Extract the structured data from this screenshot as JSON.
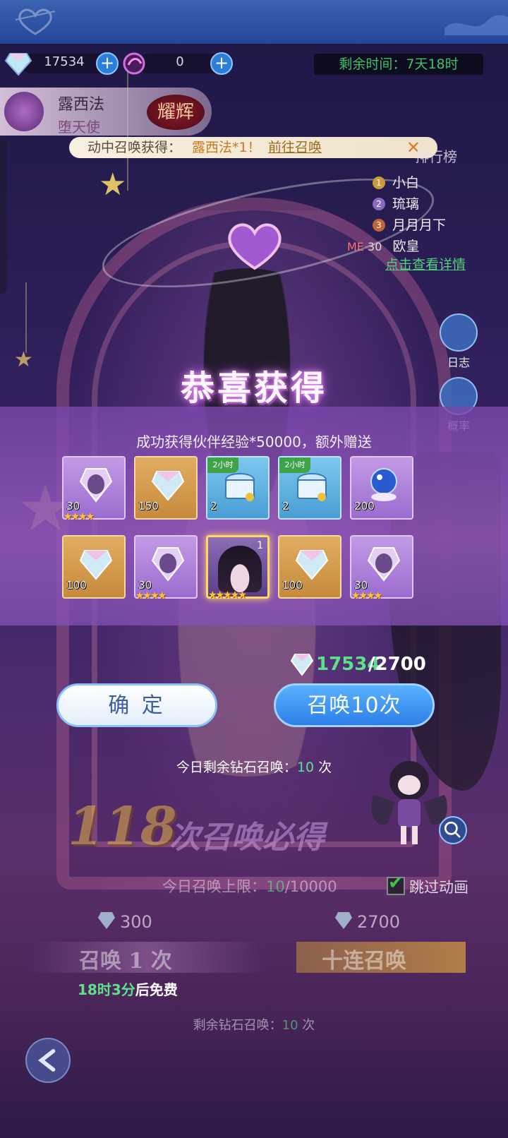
{
  "resources": {
    "diamonds": "17534",
    "soul_gems": "0"
  },
  "event": {
    "timer_label": "剩余时间：7天18时"
  },
  "character": {
    "name": "露西法",
    "title": "堕天使",
    "grade": "耀辉"
  },
  "notice": {
    "prefix": "动中召唤获得：",
    "highlight": "露西法*1！",
    "link": "前往召唤"
  },
  "ranking": {
    "title": "排行榜",
    "entries": [
      {
        "rank": "1",
        "name": "小白"
      },
      {
        "rank": "2",
        "name": "琉璃"
      },
      {
        "rank": "3",
        "name": "月月月下"
      }
    ],
    "me_label": "ME",
    "me_rank": "30",
    "me_name": "欧皇",
    "detail_link": "点击查看详情"
  },
  "side_buttons": {
    "log": "日志",
    "rate": "概率"
  },
  "reward_modal": {
    "title": "恭喜获得",
    "subtitle": "成功获得伙伴经验*50000，额外赠送",
    "items": [
      {
        "type": "purple-crystal",
        "qty": "30",
        "stars": "★★★★"
      },
      {
        "type": "rainbow-diamond",
        "qty": "150",
        "stars": ""
      },
      {
        "type": "treasure-chest",
        "qty": "2",
        "tag": "2小时",
        "stars": ""
      },
      {
        "type": "treasure-chest",
        "qty": "2",
        "tag": "2小时",
        "stars": ""
      },
      {
        "type": "crystal-orb",
        "qty": "200",
        "stars": ""
      },
      {
        "type": "rainbow-diamond",
        "qty": "100",
        "stars": ""
      },
      {
        "type": "purple-crystal",
        "qty": "30",
        "stars": "★★★★"
      },
      {
        "type": "character-card",
        "qty": "1",
        "stars": "★★★★★"
      },
      {
        "type": "rainbow-diamond",
        "qty": "100",
        "stars": ""
      },
      {
        "type": "purple-crystal",
        "qty": "30",
        "stars": "★★★★"
      }
    ],
    "cost_have": "17534",
    "cost_need": "/2700",
    "confirm_label": "确 定",
    "summon10_label": "召唤10次",
    "remaining_prefix": "今日剩余钻石召唤：",
    "remaining_count": "10",
    "remaining_suffix": " 次"
  },
  "background_panel": {
    "guarantee_number": "118",
    "guarantee_text": "次召唤必得",
    "daily_limit_prefix": "今日召唤上限：",
    "daily_limit_used": "10",
    "daily_limit_total": "/10000",
    "skip_animation_label": "跳过动画",
    "single_price": "300",
    "ten_price": "2700",
    "summon1_label": "召唤 1 次",
    "summon10_label": "十连召唤",
    "free_time": "18时3分",
    "free_suffix": "后免费",
    "remaining_prefix": "剩余钻石召唤：",
    "remaining_count": "10",
    "remaining_suffix": " 次"
  },
  "colors": {
    "accent_green": "#5ee08a",
    "accent_blue": "#2c7ee8",
    "modal_purple": "#9a6ccf",
    "gold": "#e6b34a"
  }
}
